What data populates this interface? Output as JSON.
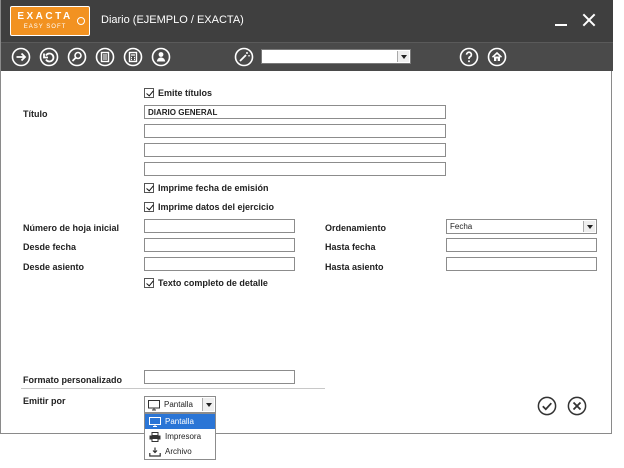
{
  "window": {
    "logo_line1": "EXACTA",
    "logo_line2": "EASY SOFT",
    "title": "Diario (EJEMPLO / EXACTA)"
  },
  "toolbar": {
    "icons": [
      "arrow-right-icon",
      "undo-icon",
      "search-icon",
      "document-icon",
      "calculator-icon",
      "user-icon",
      "magic-wand-icon",
      "help-icon",
      "home-icon"
    ],
    "combo_value": ""
  },
  "form": {
    "emite_titulos": {
      "label": "Emite títulos",
      "checked": true
    },
    "titulo_label": "Título",
    "titulo_lines": [
      "DIARIO GENERAL",
      "",
      "",
      ""
    ],
    "imprime_fecha": {
      "label": "Imprime fecha de emisión",
      "checked": true
    },
    "imprime_datos": {
      "label": "Imprime datos del ejercicio",
      "checked": true
    },
    "numero_hoja_label": "Número de hoja inicial",
    "numero_hoja_value": "",
    "desde_fecha_label": "Desde fecha",
    "desde_fecha_value": "",
    "desde_asiento_label": "Desde asiento",
    "desde_asiento_value": "",
    "ordenamiento_label": "Ordenamiento",
    "ordenamiento_value": "Fecha",
    "hasta_fecha_label": "Hasta fecha",
    "hasta_fecha_value": "",
    "hasta_asiento_label": "Hasta asiento",
    "hasta_asiento_value": "",
    "texto_completo": {
      "label": "Texto completo de detalle",
      "checked": true
    },
    "formato_label": "Formato personalizado",
    "formato_value": "",
    "emitir_label": "Emitir por",
    "emitir_value": "Pantalla",
    "emitir_options": [
      "Pantalla",
      "Impresora",
      "Archivo"
    ],
    "emitir_selected_index": 0
  },
  "colors": {
    "titlebar": "#3f3f3f",
    "toolbar": "#4a4a4a",
    "logo": "#f29221",
    "selection": "#2a75d6"
  }
}
